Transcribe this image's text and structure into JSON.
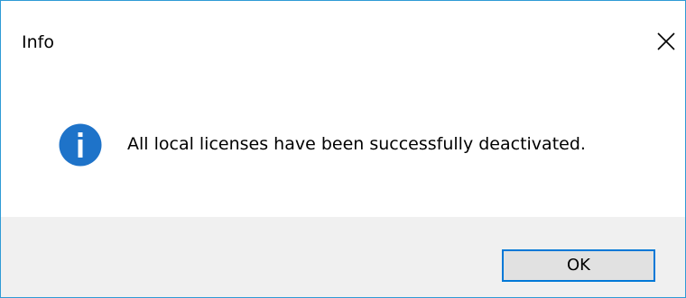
{
  "window": {
    "title": "Info",
    "close_icon": "close-icon"
  },
  "content": {
    "icon": "info-icon",
    "icon_color": "#1e73c9",
    "message": "All local licenses have been successfully deactivated."
  },
  "footer": {
    "ok_label": "OK"
  },
  "colors": {
    "border": "#2f9bd6",
    "footer_bg": "#f0f0f0",
    "button_bg": "#e1e1e1",
    "button_focus_border": "#0078d7"
  }
}
